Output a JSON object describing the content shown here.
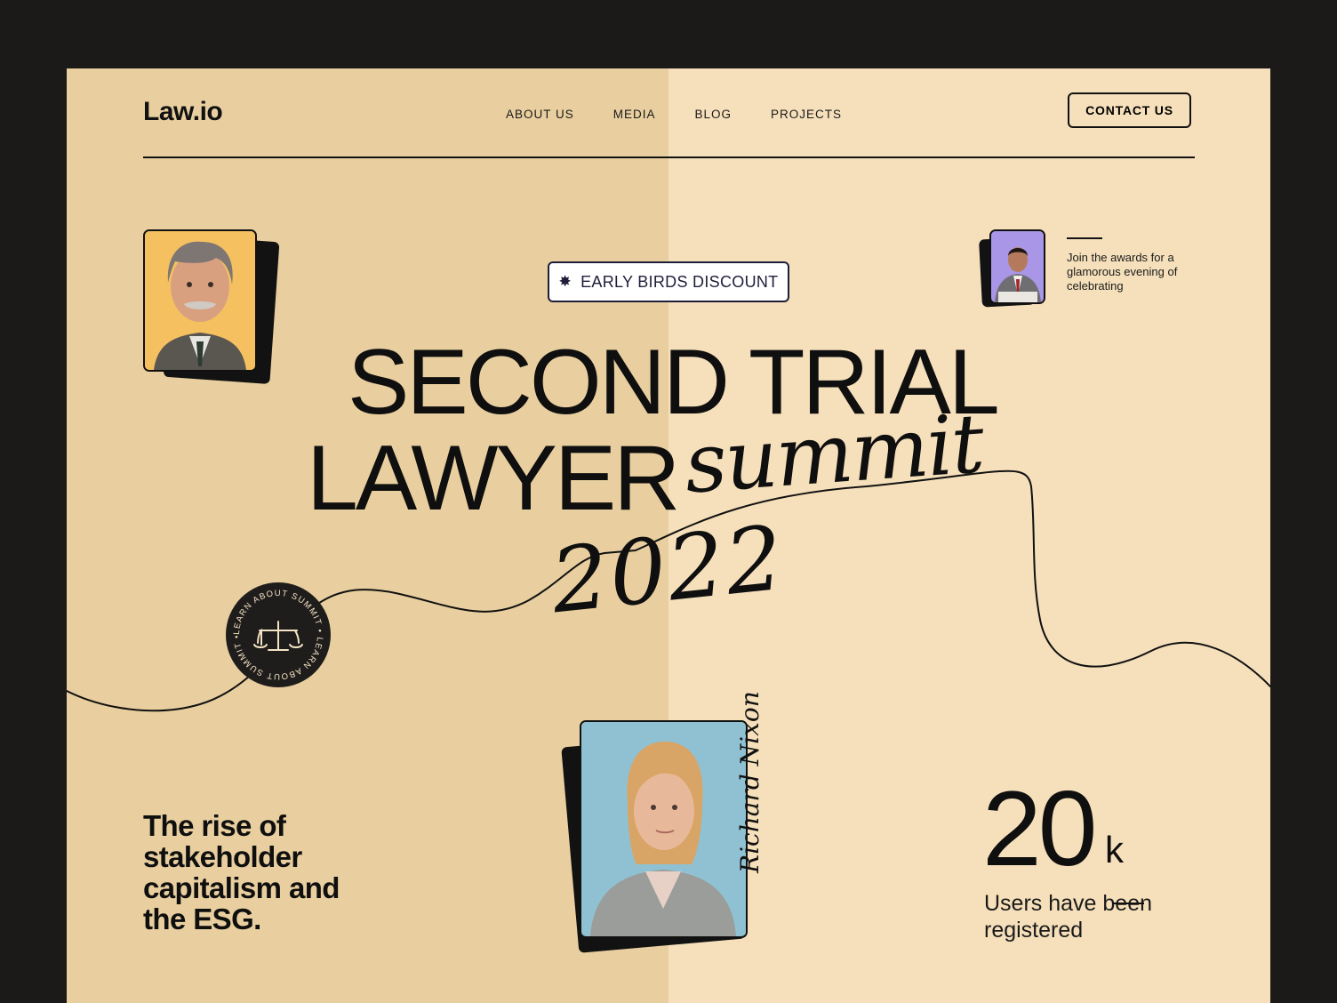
{
  "header": {
    "logo": "Law.io",
    "nav": [
      "ABOUT US",
      "MEDIA",
      "BLOG",
      "PROJECTS"
    ],
    "contact_label": "CONTACT US"
  },
  "hero": {
    "badge_icon": "burst-star-icon",
    "badge_label": "EARLY BIRDS DISCOUNT",
    "title_line1": "SECOND TRIAL",
    "title_line2": "LAWYER",
    "title_script": "summit",
    "title_year": "2022"
  },
  "awards": {
    "text": "Join the awards for a glamorous evening of celebrating"
  },
  "seal": {
    "ring_text": "LEARN ABOUT SUMMIT • LEARN ABOUT SUMMIT •",
    "icon": "scales-of-justice-icon"
  },
  "tagline": "The rise of stakeholder capitalism and the ESG.",
  "stat": {
    "value": "20",
    "unit": "k",
    "label": "Users have been registered"
  },
  "signature": "Richard Nixon",
  "colors": {
    "left_panel": "#e9cf9f",
    "right_panel": "#f6e0bb",
    "frame": "#1b1a19",
    "badge_text": "#1e1e3a",
    "portrait_bg_1": "#f5c060",
    "portrait_bg_2": "#a996e6",
    "portrait_bg_3": "#8fc1d2"
  }
}
